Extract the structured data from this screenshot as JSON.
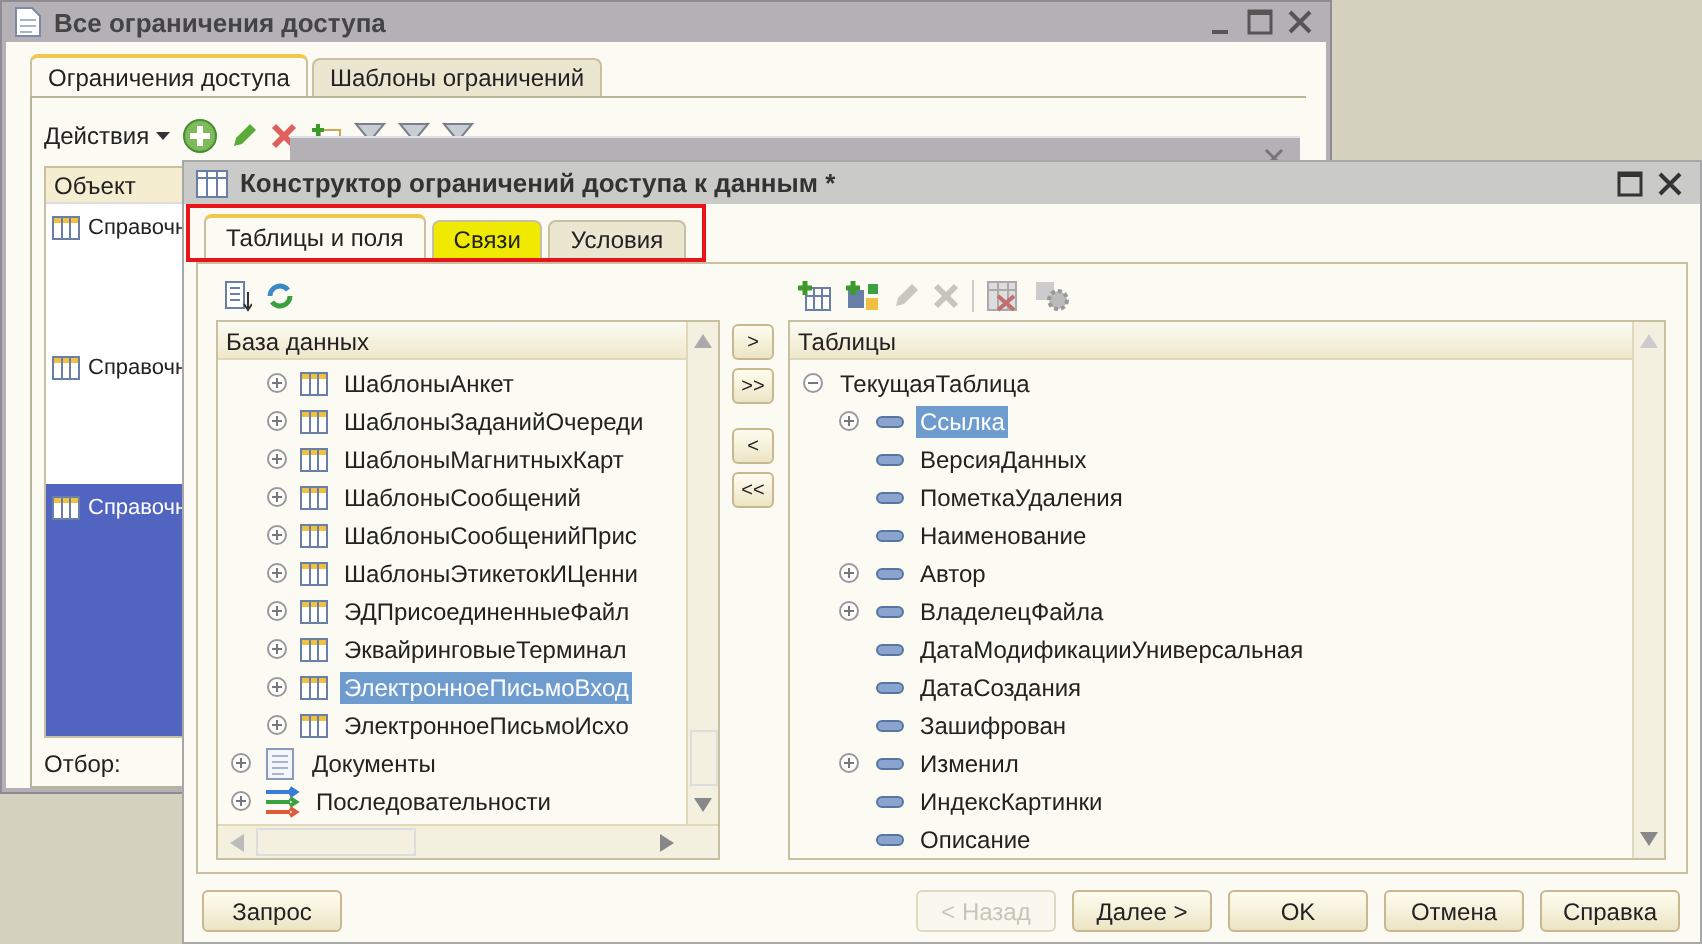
{
  "back_window": {
    "title": "Все ограничения доступа",
    "tabs": [
      {
        "label": "Ограничения доступа",
        "selected": true
      },
      {
        "label": "Шаблоны ограничений",
        "selected": false
      }
    ],
    "actions_menu": "Действия",
    "table": {
      "columns": [
        "Объект"
      ],
      "rows": [
        {
          "cell": "Справочн",
          "selected": false
        },
        {
          "cell": "Справочн",
          "selected": false
        },
        {
          "cell": "Справочн",
          "selected": true
        }
      ]
    },
    "filter_label": "Отбор:"
  },
  "dialog": {
    "title": "Конструктор ограничений доступа к данным *",
    "tabs": [
      {
        "label": "Таблицы и поля",
        "selected": true,
        "highlighted": false
      },
      {
        "label": "Связи",
        "selected": false,
        "highlighted": true
      },
      {
        "label": "Условия",
        "selected": false,
        "highlighted": false
      }
    ],
    "database_panel": {
      "header": "База данных",
      "items": [
        {
          "kind": "group",
          "children": [
            {
              "label": "ШаблоныАнкет",
              "selected": false
            },
            {
              "label": "ШаблоныЗаданийОчереди",
              "selected": false
            },
            {
              "label": "ШаблоныМагнитныхКарт",
              "selected": false
            },
            {
              "label": "ШаблоныСообщений",
              "selected": false
            },
            {
              "label": "ШаблоныСообщенийПрис",
              "selected": false
            },
            {
              "label": "ШаблоныЭтикетокИЦенни",
              "selected": false
            },
            {
              "label": "ЭДПрисоединенныеФайл",
              "selected": false
            },
            {
              "label": "ЭквайринговыеТерминал",
              "selected": false
            },
            {
              "label": "ЭлектронноеПисьмоВход",
              "selected": true
            },
            {
              "label": "ЭлектронноеПисьмоИсхо",
              "selected": false
            }
          ]
        },
        {
          "kind": "documents",
          "label": "Документы",
          "selected": false
        },
        {
          "kind": "sequences",
          "label": "Последовательности",
          "selected": false
        }
      ]
    },
    "transfer_buttons": [
      ">",
      ">>",
      "<",
      "<<"
    ],
    "tables_panel": {
      "header": "Таблицы",
      "items": [
        {
          "label": "ТекущаяТаблица",
          "expanded": true,
          "selected": false,
          "children": [
            {
              "label": "Ссылка",
              "expandable": true,
              "selected": true
            },
            {
              "label": "ВерсияДанных",
              "expandable": false,
              "selected": false
            },
            {
              "label": "ПометкаУдаления",
              "expandable": false,
              "selected": false
            },
            {
              "label": "Наименование",
              "expandable": false,
              "selected": false
            },
            {
              "label": "Автор",
              "expandable": true,
              "selected": false
            },
            {
              "label": "ВладелецФайла",
              "expandable": true,
              "selected": false
            },
            {
              "label": "ДатаМодификацииУниверсальная",
              "expandable": false,
              "selected": false
            },
            {
              "label": "ДатаСоздания",
              "expandable": false,
              "selected": false
            },
            {
              "label": "Зашифрован",
              "expandable": false,
              "selected": false
            },
            {
              "label": "Изменил",
              "expandable": true,
              "selected": false
            },
            {
              "label": "ИндексКартинки",
              "expandable": false,
              "selected": false
            },
            {
              "label": "Описание",
              "expandable": false,
              "selected": false
            }
          ]
        }
      ]
    },
    "buttons": [
      {
        "label": "Запрос",
        "disabled": false
      },
      {
        "label": "< Назад",
        "disabled": true
      },
      {
        "label": "Далее >",
        "disabled": false
      },
      {
        "label": "OK",
        "disabled": false
      },
      {
        "label": "Отмена",
        "disabled": false
      },
      {
        "label": "Справка",
        "disabled": false
      }
    ]
  }
}
